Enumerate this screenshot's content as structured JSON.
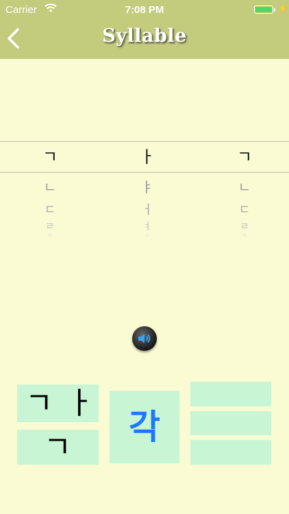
{
  "status_bar": {
    "carrier": "Carrier",
    "time": "7:08 PM",
    "battery_fill": 1.0
  },
  "nav": {
    "title": "Syllable"
  },
  "picker": {
    "columns": [
      {
        "name": "initial",
        "selected": "ㄱ",
        "below": [
          "ㄴ",
          "ㄷ",
          "ㄹ",
          "ㅁ"
        ]
      },
      {
        "name": "vowel",
        "selected": "ㅏ",
        "below": [
          "ㅑ",
          "ㅓ",
          "ㅕ",
          "ㅗ"
        ]
      },
      {
        "name": "final",
        "selected": "ㄱ",
        "below": [
          "ㄴ",
          "ㄷ",
          "ㄹ",
          "ㅁ"
        ]
      }
    ]
  },
  "composition": {
    "initial": "ㄱ",
    "vowel": "ㅏ",
    "final": "ㄱ",
    "result": "각"
  },
  "colors": {
    "nav_bg": "#c3cb7d",
    "page_bg": "#fafbd3",
    "box_bg": "#c8f5d4",
    "result_text": "#1e78ff"
  }
}
